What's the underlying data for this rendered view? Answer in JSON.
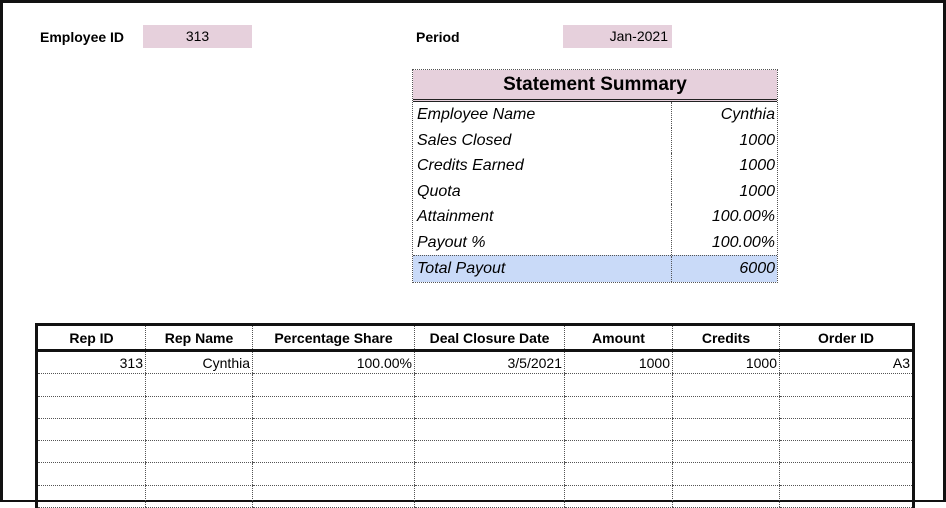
{
  "header": {
    "employee_id_label": "Employee ID",
    "employee_id_value": "313",
    "period_label": "Period",
    "period_value": "Jan-2021"
  },
  "summary": {
    "title": "Statement Summary",
    "rows": [
      {
        "label": "Employee Name",
        "value": "Cynthia"
      },
      {
        "label": "Sales Closed",
        "value": "1000"
      },
      {
        "label": "Credits Earned",
        "value": "1000"
      },
      {
        "label": "Quota",
        "value": "1000"
      },
      {
        "label": "Attainment",
        "value": "100.00%"
      },
      {
        "label": "Payout %",
        "value": "100.00%"
      }
    ],
    "total": {
      "label": "Total Payout",
      "value": "6000"
    }
  },
  "rep_table": {
    "columns": [
      "Rep ID",
      "Rep Name",
      "Percentage Share",
      "Deal Closure Date",
      "Amount",
      "Credits",
      "Order ID"
    ],
    "rows": [
      [
        "313",
        "Cynthia",
        "100.00%",
        "3/5/2021",
        "1000",
        "1000",
        "A3"
      ],
      [
        "",
        "",
        "",
        "",
        "",
        "",
        ""
      ],
      [
        "",
        "",
        "",
        "",
        "",
        "",
        ""
      ],
      [
        "",
        "",
        "",
        "",
        "",
        "",
        ""
      ],
      [
        "",
        "",
        "",
        "",
        "",
        "",
        ""
      ],
      [
        "",
        "",
        "",
        "",
        "",
        "",
        ""
      ],
      [
        "",
        "",
        "",
        "",
        "",
        "",
        ""
      ]
    ]
  },
  "colors": {
    "field_pink": "#e6d0dc",
    "total_blue": "#c9daf8"
  }
}
